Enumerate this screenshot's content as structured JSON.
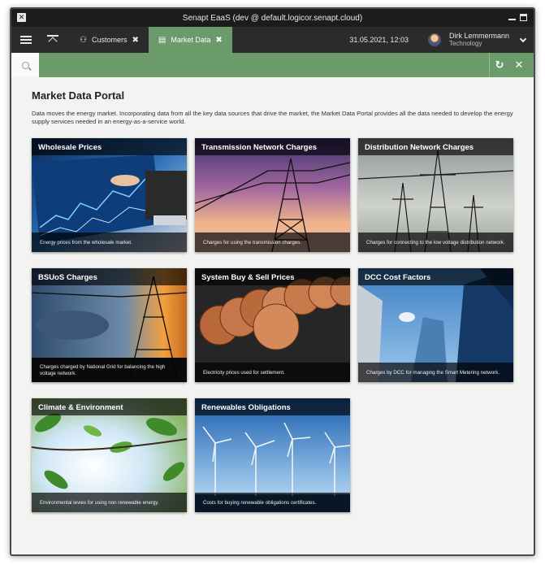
{
  "window": {
    "title": "Senapt EaaS (dev @ default.logicor.senapt.cloud)"
  },
  "nav": {
    "tabs": [
      {
        "label": "Customers",
        "icon": "users-icon",
        "active": false
      },
      {
        "label": "Market Data",
        "icon": "document-icon",
        "active": true
      }
    ],
    "datetime": "31.05.2021, 12:03",
    "user": {
      "name": "Dirk Lemmermann",
      "role": "Technology"
    }
  },
  "search": {
    "value": "",
    "placeholder": ""
  },
  "page": {
    "title": "Market Data Portal",
    "intro": "Data moves the energy market. Incorporating data from all the key data sources that drive the market, the Market Data Portal provides all the data needed to develop the energy supply services needed in an energy-as-a-service world."
  },
  "cards": [
    {
      "title": "Wholesale Prices",
      "desc": "Energy prices from the wholesale market."
    },
    {
      "title": "Transmission Network Charges",
      "desc": "Charges for using the transmission charges."
    },
    {
      "title": "Distribution Network Charges",
      "desc": "Charges for connecting to the low voltage distribution network."
    },
    {
      "title": "BSUoS Charges",
      "desc": "Charges charged by National Grid for balancing the high voltage network."
    },
    {
      "title": "System Buy & Sell Prices",
      "desc": "Electricity prices used for settlement."
    },
    {
      "title": "DCC Cost Factors",
      "desc": "Charges by DCC for managing the Smart Metering network."
    },
    {
      "title": "Climate & Environment",
      "desc": "Environmental levies for using non renewable energy."
    },
    {
      "title": "Renewables Obligations",
      "desc": "Costs for buying renewable obligations certificates."
    }
  ],
  "colors": {
    "accent": "#6b9a6b",
    "navbar": "#2b2b2b",
    "titlebar": "#1c1c1c"
  }
}
